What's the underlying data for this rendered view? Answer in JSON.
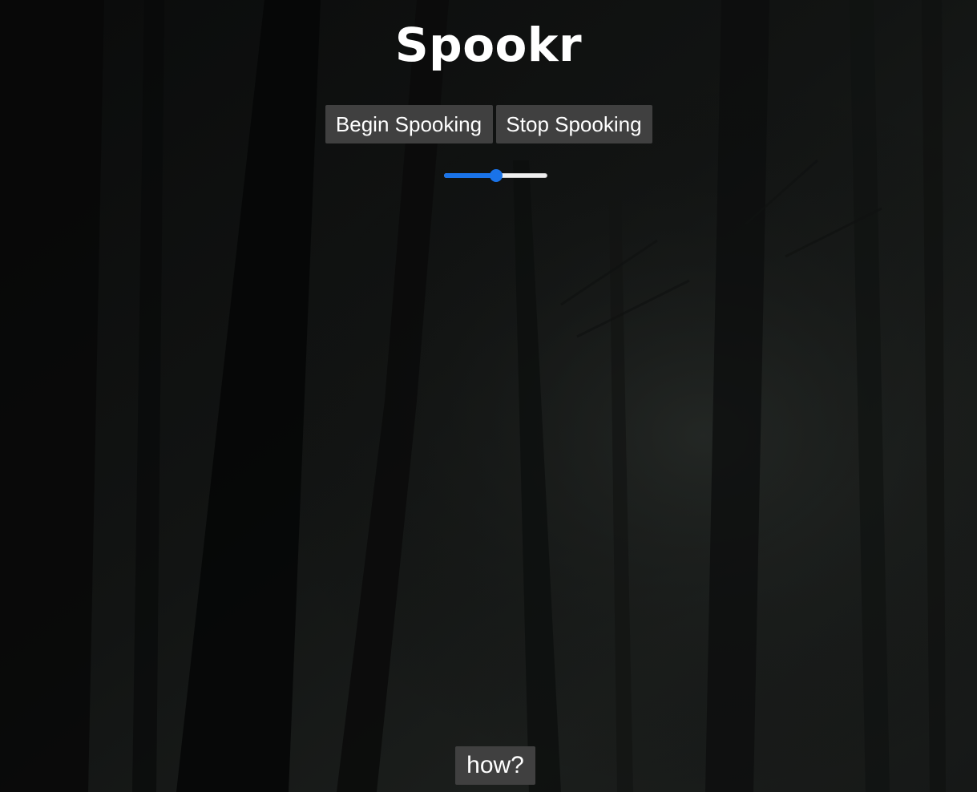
{
  "app": {
    "title": "Spookr"
  },
  "controls": {
    "begin_label": "Begin Spooking",
    "stop_label": "Stop Spooking"
  },
  "volume_slider": {
    "value_percent": 50
  },
  "footer": {
    "how_label": "how?"
  },
  "colors": {
    "accent": "#1a73e8",
    "button_bg": "#404040",
    "text": "#ffffff",
    "background": "#0c0d0d"
  }
}
